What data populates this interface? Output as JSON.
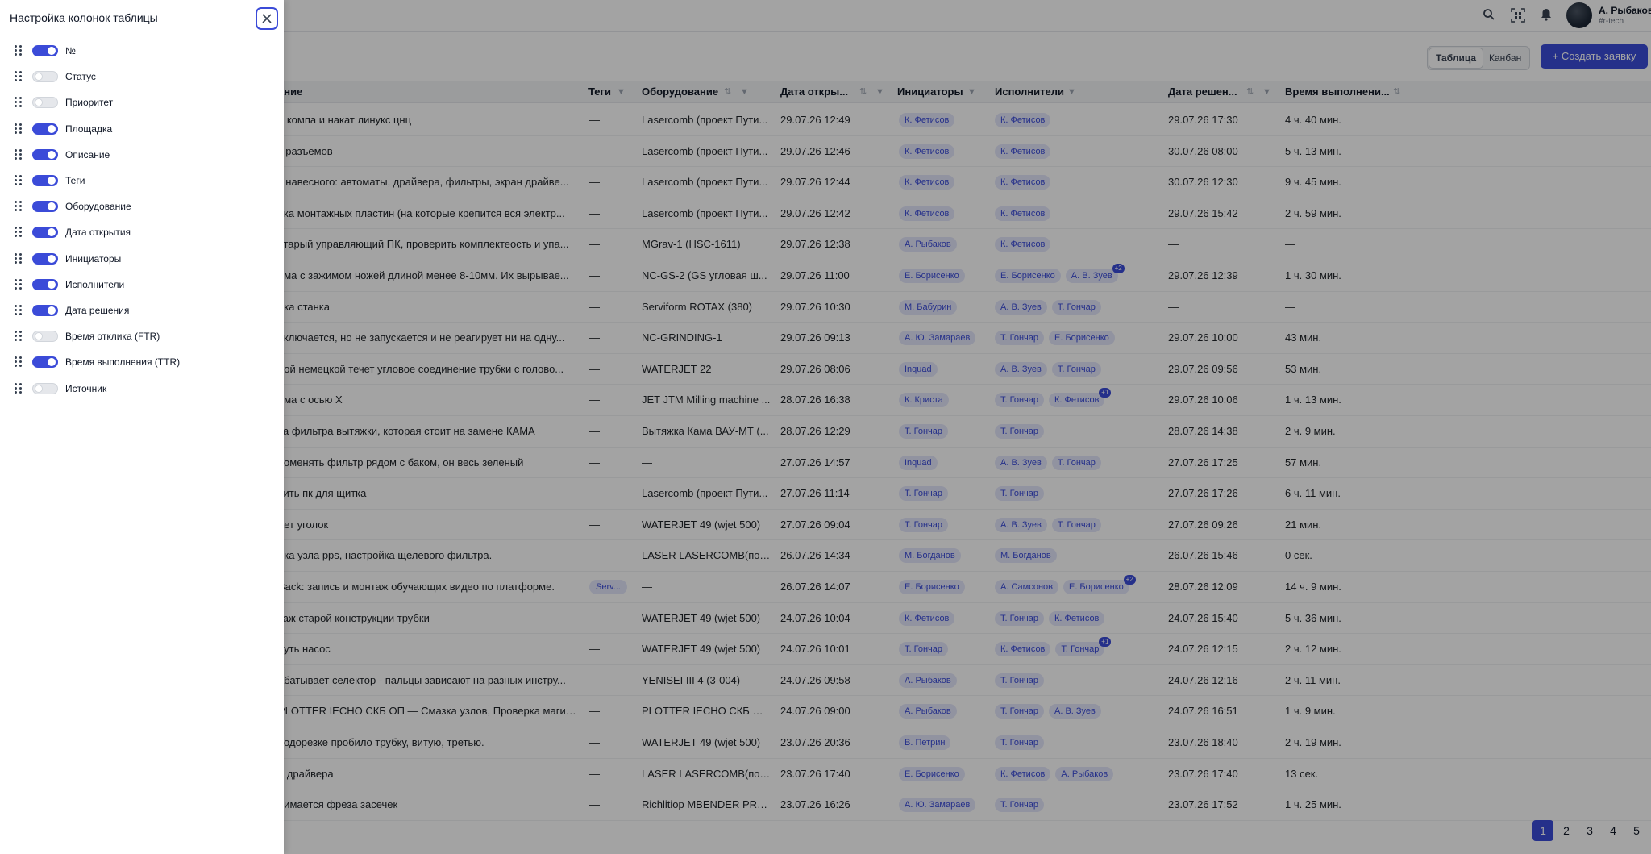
{
  "header": {
    "user_name": "А. Рыбаков",
    "user_org": "#r-tech",
    "icons": [
      "search-icon",
      "qr-scan-icon",
      "bell-icon"
    ]
  },
  "toolbar": {
    "view_table": "Таблица",
    "view_kanban": "Канбан",
    "active_view": "Таблица",
    "create_label": "+ Создать заявку"
  },
  "table": {
    "headers": {
      "description": "ание",
      "tags": "Теги",
      "equipment": "Оборудование",
      "opened": "Дата откры...",
      "initiators": "Инициаторы",
      "executors": "Исполнители",
      "resolved": "Дата решен...",
      "ttr": "Время выполнени..."
    },
    "rows": [
      {
        "desc": "о компа и накат линукс цнц",
        "tags": "—",
        "equip": "Lasercomb (проект Пути...",
        "opened": "29.07.26 12:49",
        "initiators": [
          "К. Фетисов"
        ],
        "executors": [
          "К. Фетисов"
        ],
        "more": "",
        "resolved": "29.07.26 17:30",
        "ttr": "4 ч. 40 мин."
      },
      {
        "desc": "к разъемов",
        "tags": "—",
        "equip": "Lasercomb (проект Пути...",
        "opened": "29.07.26 12:46",
        "initiators": [
          "К. Фетисов"
        ],
        "executors": [
          "К. Фетисов"
        ],
        "more": "",
        "resolved": "30.07.26 08:00",
        "ttr": "5 ч. 13 мин."
      },
      {
        "desc": "к навесного: автоматы, драйвера, фильтры, экран драйве...",
        "tags": "—",
        "equip": "Lasercomb (проект Пути...",
        "opened": "29.07.26 12:44",
        "initiators": [
          "К. Фетисов"
        ],
        "executors": [
          "К. Фетисов"
        ],
        "more": "",
        "resolved": "30.07.26 12:30",
        "ttr": "9 ч. 45 мин."
      },
      {
        "desc": "вка монтажных пластин (на которые крепится вся электр...",
        "tags": "—",
        "equip": "Lasercomb (проект Пути...",
        "opened": "29.07.26 12:42",
        "initiators": [
          "К. Фетисов"
        ],
        "executors": [
          "К. Фетисов"
        ],
        "more": "",
        "resolved": "29.07.26 15:42",
        "ttr": "2 ч. 59 мин."
      },
      {
        "desc": "старый управляющий ПК, проверить комплектеость и упа...",
        "tags": "—",
        "equip": "MGrav-1 (HSC-1611)",
        "opened": "29.07.26 12:38",
        "initiators": [
          "А. Рыбаков"
        ],
        "executors": [
          "К. Фетисов"
        ],
        "more": "",
        "resolved": "—",
        "ttr": "—"
      },
      {
        "desc": "ема с зажимом ножей длиной менее 8-10мм. Их вырывае...",
        "tags": "—",
        "equip": "NC-GS-2 (GS угловая ш...",
        "opened": "29.07.26 11:00",
        "initiators": [
          "Е. Борисенко"
        ],
        "executors": [
          "Е. Борисенко",
          "А. В. Зуев"
        ],
        "more": "+2",
        "resolved": "29.07.26 12:39",
        "ttr": "1 ч. 30 мин."
      },
      {
        "desc": "йка станка",
        "tags": "—",
        "equip": "Serviform ROTAX (380)",
        "opened": "29.07.26 10:30",
        "initiators": [
          "М. Бабурин"
        ],
        "executors": [
          "А. В. Зуев",
          "Т. Гончар"
        ],
        "more": "",
        "resolved": "—",
        "ttr": "—"
      },
      {
        "desc": "включается, но не запускается и не реагирует ни на одну...",
        "tags": "—",
        "equip": "NC-GRINDING-1",
        "opened": "29.07.26 09:13",
        "initiators": [
          "А. Ю. Замараев"
        ],
        "executors": [
          "Т. Гончар",
          "Е. Борисенко"
        ],
        "more": "",
        "resolved": "29.07.26 10:00",
        "ttr": "43 мин."
      },
      {
        "desc": "рой немецкой течет угловое соединение трубки с голово...",
        "tags": "—",
        "equip": "WATERJET 22",
        "opened": "29.07.26 08:06",
        "initiators": [
          "Inquad"
        ],
        "executors": [
          "А. В. Зуев",
          "Т. Гончар"
        ],
        "more": "",
        "resolved": "29.07.26 09:56",
        "ttr": "53 мин."
      },
      {
        "desc": "ема с осью Х",
        "tags": "—",
        "equip": "JET JTM Milling machine ...",
        "opened": "28.07.26 16:38",
        "initiators": [
          "К. Криста"
        ],
        "executors": [
          "Т. Гончар",
          "К. Фетисов"
        ],
        "more": "+1",
        "resolved": "29.07.26 10:06",
        "ttr": "1 ч. 13 мин."
      },
      {
        "desc": "ка фильтра вытяжки, которая стоит на замене КАМА",
        "tags": "—",
        "equip": "Вытяжка Кама ВАУ-МТ (...",
        "opened": "28.07.26 12:29",
        "initiators": [
          "Т. Гончар"
        ],
        "executors": [
          "Т. Гончар"
        ],
        "more": "",
        "resolved": "28.07.26 14:38",
        "ttr": "2 ч. 9 мин."
      },
      {
        "desc": "поменять фильтр рядом с баком, он весь зеленый",
        "tags": "—",
        "equip": "—",
        "opened": "27.07.26 14:57",
        "initiators": [
          "Inquad"
        ],
        "executors": [
          "А. В. Зуев",
          "Т. Гончар"
        ],
        "more": "",
        "resolved": "27.07.26 17:25",
        "ttr": "57 мин."
      },
      {
        "desc": "сить пк для щитка",
        "tags": "—",
        "equip": "Lasercomb (проект Пути...",
        "opened": "27.07.26 11:14",
        "initiators": [
          "Т. Гончар"
        ],
        "executors": [
          "Т. Гончар"
        ],
        "more": "",
        "resolved": "27.07.26 17:26",
        "ttr": "6 ч. 11 мин."
      },
      {
        "desc": "ает уголок",
        "tags": "—",
        "equip": "WATERJET 49 (wjet 500)",
        "opened": "27.07.26 09:04",
        "initiators": [
          "Т. Гончар"
        ],
        "executors": [
          "А. В. Зуев",
          "Т. Гончар"
        ],
        "more": "",
        "resolved": "27.07.26 09:26",
        "ttr": "21 мин."
      },
      {
        "desc": "йка узла pps, настройка щелевого фильтра.",
        "tags": "—",
        "equip": "LASER LASERCOMB(под...",
        "opened": "26.07.26 14:34",
        "initiators": [
          "М. Богданов"
        ],
        "executors": [
          "М. Богданов"
        ],
        "more": "",
        "resolved": "26.07.26 15:46",
        "ttr": "0 сек."
      },
      {
        "desc": "Back: запись и монтаж обучающих видео по платформе.",
        "tags": "Serv...",
        "equip": "—",
        "opened": "26.07.26 14:07",
        "initiators": [
          "Е. Борисенко"
        ],
        "executors": [
          "А. Самсонов",
          "Е. Борисенко"
        ],
        "more": "+2",
        "resolved": "28.07.26 12:09",
        "ttr": "14 ч. 9 мин."
      },
      {
        "desc": "таж старой конструкции трубки",
        "tags": "—",
        "equip": "WATERJET 49 (wjet 500)",
        "opened": "24.07.26 10:04",
        "initiators": [
          "К. Фетисов"
        ],
        "executors": [
          "Т. Гончар",
          "К. Фетисов"
        ],
        "more": "",
        "resolved": "24.07.26 15:40",
        "ttr": "5 ч. 36 мин."
      },
      {
        "desc": "нуть насос",
        "tags": "—",
        "equip": "WATERJET 49 (wjet 500)",
        "opened": "24.07.26 10:01",
        "initiators": [
          "Т. Гончар"
        ],
        "executors": [
          "К. Фетисов",
          "Т. Гончар"
        ],
        "more": "+1",
        "resolved": "24.07.26 12:15",
        "ttr": "2 ч. 12 мин."
      },
      {
        "desc": "абатывает селектор - пальцы зависают на разных инстру...",
        "tags": "—",
        "equip": "YENISEI III 4 (3-004)",
        "opened": "24.07.26 09:58",
        "initiators": [
          "А. Рыбаков"
        ],
        "executors": [
          "Т. Гончар"
        ],
        "more": "",
        "resolved": "24.07.26 12:16",
        "ttr": "2 ч. 11 мин."
      },
      {
        "desc": "PLOTTER IECHO СКБ ОП — Смазка узлов, Проверка магист...",
        "tags": "—",
        "equip": "PLOTTER IECHO СКБ ОП...",
        "opened": "24.07.26 09:00",
        "initiators": [
          "А. Рыбаков"
        ],
        "executors": [
          "Т. Гончар",
          "А. В. Зуев"
        ],
        "more": "",
        "resolved": "24.07.26 16:51",
        "ttr": "1 ч. 9 мин."
      },
      {
        "desc": "подорезке пробило трубку, витую, третью.",
        "tags": "—",
        "equip": "WATERJET 49 (wjet 500)",
        "opened": "23.07.26 20:36",
        "initiators": [
          "В. Петрин"
        ],
        "executors": [
          "Т. Гончар"
        ],
        "more": "",
        "resolved": "23.07.26 18:40",
        "ttr": "2 ч. 19 мин."
      },
      {
        "desc": "а драйвера",
        "tags": "—",
        "equip": "LASER LASERCOMB(под...",
        "opened": "23.07.26 17:40",
        "initiators": [
          "Е. Борисенко"
        ],
        "executors": [
          "К. Фетисов",
          "А. Рыбаков"
        ],
        "more": "",
        "resolved": "23.07.26 17:40",
        "ttr": "13 сек."
      },
      {
        "desc": "нимается фреза засечек",
        "tags": "—",
        "equip": "Richlitiop MBENDER PRO...",
        "opened": "23.07.26 16:26",
        "initiators": [
          "А. Ю. Замараев"
        ],
        "executors": [
          "Т. Гончар"
        ],
        "more": "",
        "resolved": "23.07.26 17:52",
        "ttr": "1 ч. 25 мин."
      }
    ]
  },
  "pagination": {
    "pages": [
      "1",
      "2",
      "3",
      "4",
      "5"
    ],
    "current": "1"
  },
  "column_settings": {
    "title": "Настройка колонок таблицы",
    "close_icon": "close-icon",
    "accent": "#3b4bd8",
    "columns": [
      {
        "label": "№",
        "enabled": true
      },
      {
        "label": "Статус",
        "enabled": false
      },
      {
        "label": "Приоритет",
        "enabled": false
      },
      {
        "label": "Площадка",
        "enabled": true
      },
      {
        "label": "Описание",
        "enabled": true
      },
      {
        "label": "Теги",
        "enabled": true
      },
      {
        "label": "Оборудование",
        "enabled": true
      },
      {
        "label": "Дата открытия",
        "enabled": true
      },
      {
        "label": "Инициаторы",
        "enabled": true
      },
      {
        "label": "Исполнители",
        "enabled": true
      },
      {
        "label": "Дата решения",
        "enabled": true
      },
      {
        "label": "Время отклика (FTR)",
        "enabled": false
      },
      {
        "label": "Время выполнения (TTR)",
        "enabled": true
      },
      {
        "label": "Источник",
        "enabled": false
      }
    ]
  }
}
